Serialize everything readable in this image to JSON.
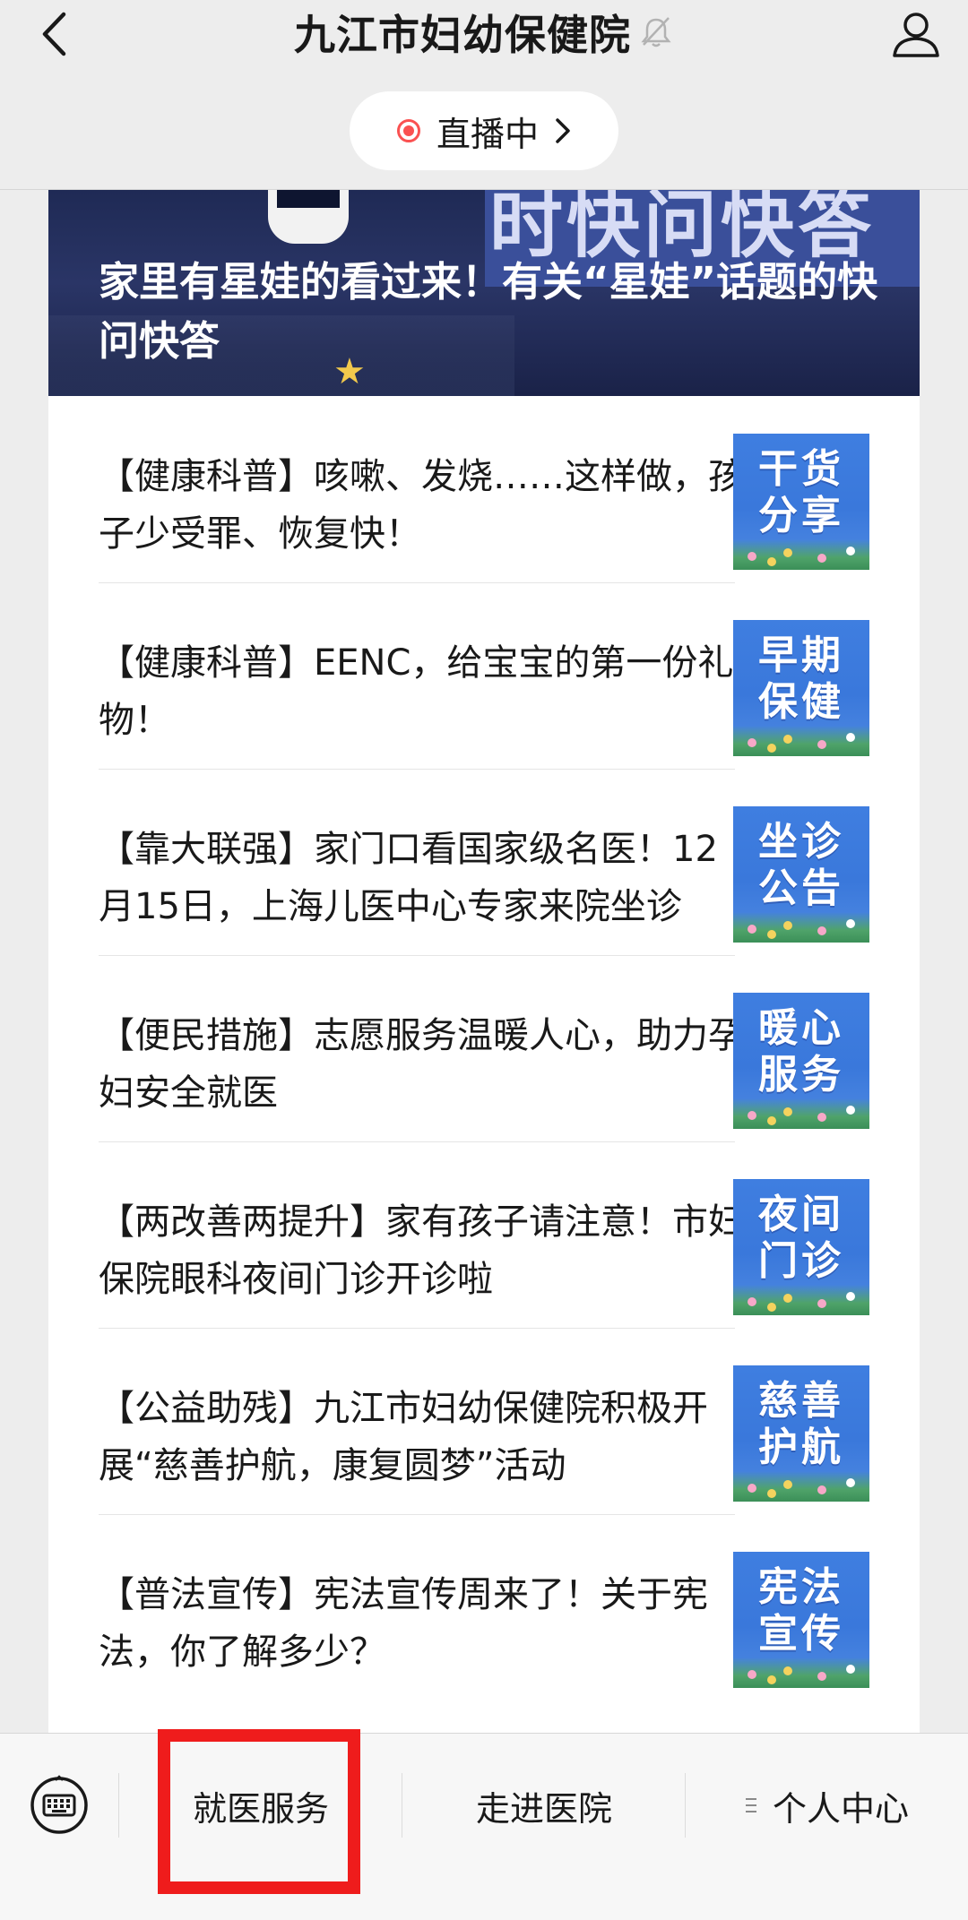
{
  "header": {
    "title": "九江市妇幼保健院",
    "back_icon": "chevron-left-icon",
    "mute_icon": "bell-muted-icon",
    "profile_icon": "person-icon",
    "live_label": "直播中"
  },
  "banner": {
    "image_text": "时快问快答",
    "title": "家里有星娃的看过来！有关“星娃”话题的快问快答"
  },
  "articles": [
    {
      "title": "【健康科普】咳嗽、发烧……这样做，孩子少受罪、恢复快！",
      "thumb": "干货\n分享"
    },
    {
      "title": "【健康科普】EENC，给宝宝的第一份礼物！",
      "thumb": "早期\n保健"
    },
    {
      "title": "【靠大联强】家门口看国家级名医！12月15日，上海儿医中心专家来院坐诊",
      "thumb": "坐诊\n公告"
    },
    {
      "title": "【便民措施】志愿服务温暖人心，助力孕妇安全就医",
      "thumb": "暖心\n服务"
    },
    {
      "title": "【两改善两提升】家有孩子请注意！市妇保院眼科夜间门诊开诊啦",
      "thumb": "夜间\n门诊"
    },
    {
      "title": "【公益助残】九江市妇幼保健院积极开展“慈善护航，康复圆梦”活动",
      "thumb": "慈善\n护航"
    },
    {
      "title": "【普法宣传】宪法宣传周来了！关于宪法，你了解多少？",
      "thumb": "宪法\n宣传"
    }
  ],
  "bottom_menu": {
    "keyboard_icon": "keyboard-icon",
    "items": [
      "就医服务",
      "走进医院",
      "个人中心"
    ],
    "highlight_color": "#ef1c1c"
  },
  "colors": {
    "live_dot": "#fa5151",
    "thumb_blue": "#3f7ee0"
  }
}
